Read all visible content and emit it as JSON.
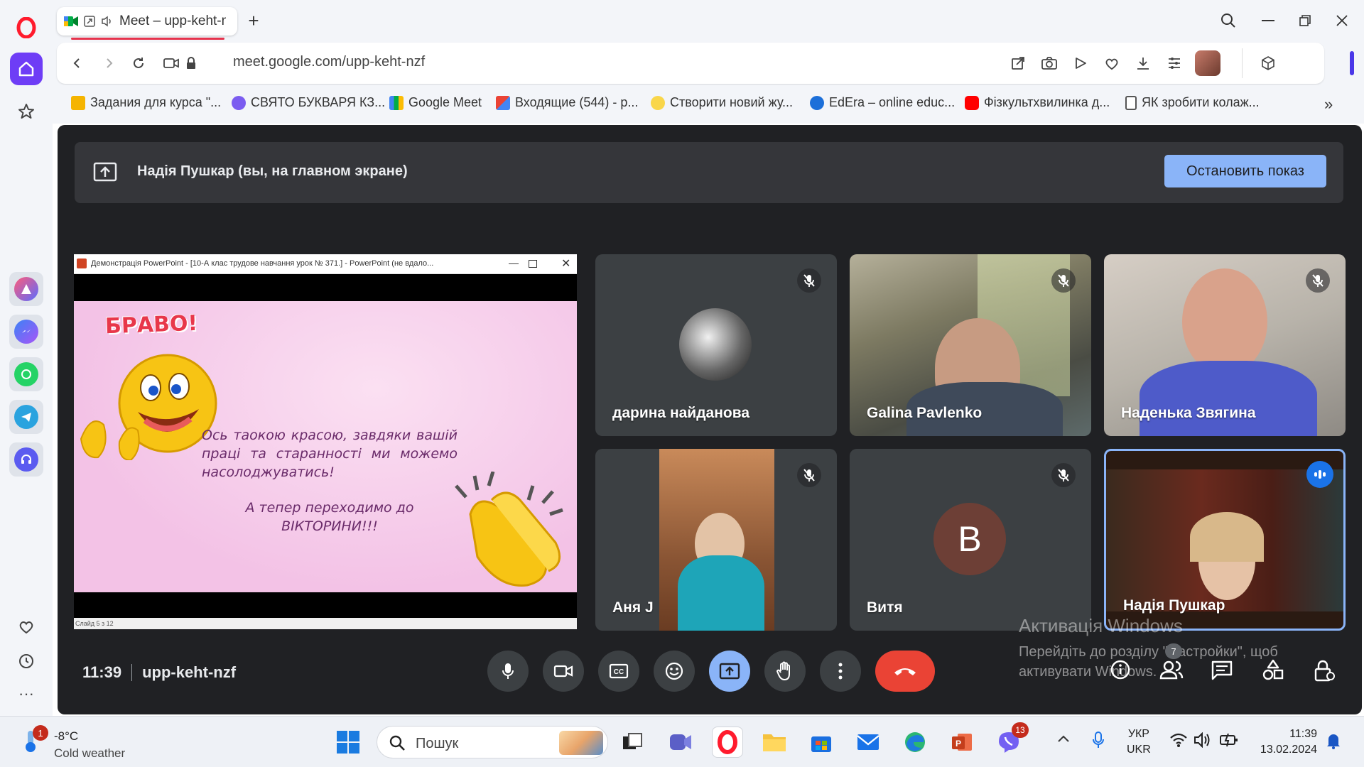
{
  "tab": {
    "title": "Meet – upp-keht-n"
  },
  "address": {
    "url": "meet.google.com/upp-keht-nzf"
  },
  "bookmarks": [
    "Задания для курса \"...",
    "СВЯТО БУКВАРЯ КЗ...",
    "Google Meet",
    "Входящие (544) - p...",
    "Створити новий жу...",
    "EdEra – online educ...",
    "Фізкультхвилинка д...",
    "ЯК зробити колаж..."
  ],
  "banner": {
    "text": "Надія Пушкар (вы, на главном экране)",
    "stop_label": "Остановить показ"
  },
  "presentation": {
    "window_title": "Демонстрація PowerPoint - [10-А клас трудове навчання урок № 371.] - PowerPoint (не вдало...",
    "bravo": "БРАВО!",
    "line1": "Ось таокою красою, завдяки вашій праці та старанності ми можемо насолоджуватись!",
    "line2": "А тепер переходимо до ВІКТОРИНИ!!!",
    "status": "Слайд 5 з 12"
  },
  "participants": [
    {
      "name": "дарина найданова",
      "muted": true
    },
    {
      "name": "Galina Pavlenko",
      "muted": true
    },
    {
      "name": "Наденька Звягина",
      "muted": true
    },
    {
      "name": "Аня J",
      "muted": true
    },
    {
      "name": "Витя",
      "muted": true,
      "initial": "B"
    },
    {
      "name": "Надія Пушкар",
      "speaking": true
    }
  ],
  "meeting": {
    "time": "11:39",
    "code": "upp-keht-nzf",
    "people_count": "7"
  },
  "watermark": {
    "title": "Активація Windows",
    "line": "Перейдіть до розділу \"Настройки\", щоб активувати Windows."
  },
  "taskbar": {
    "weather_temp": "-8°C",
    "weather_desc": "Cold weather",
    "weather_badge": "1",
    "search_label": "Пошук",
    "viber_badge": "13",
    "lang1": "УКР",
    "lang2": "UKR",
    "clock_time": "11:39",
    "clock_date": "13.02.2024"
  },
  "colors": {
    "meet_bg": "#202124",
    "tile_bg": "#3c4043",
    "accent": "#8ab4f8",
    "end_call": "#ea4335",
    "opera_red": "#ff1b2d"
  }
}
